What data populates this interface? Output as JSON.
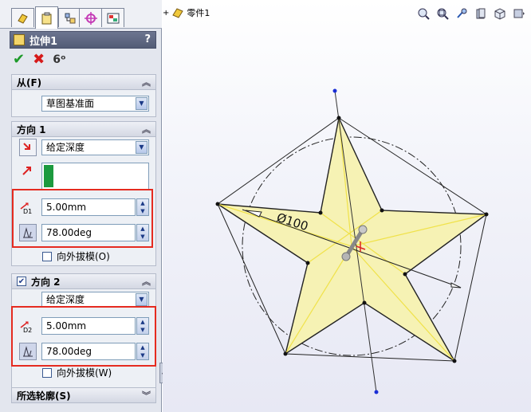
{
  "feature": {
    "title": "拉伸1",
    "help": "?"
  },
  "from": {
    "header": "从(F)",
    "value": "草图基准面"
  },
  "direction1": {
    "header": "方向 1",
    "end_condition": "给定深度",
    "depth": "5.00mm",
    "draft_angle": "78.00deg",
    "draft_outward_label": "向外拔模(O)",
    "depth_icon_label": "D1"
  },
  "direction2": {
    "header": "方向 2",
    "end_condition": "给定深度",
    "depth": "5.00mm",
    "draft_angle": "78.00deg",
    "draft_outward_label": "向外拔模(W)",
    "depth_icon_label": "D2"
  },
  "selected_contours": {
    "header": "所选轮廓(S)"
  },
  "graphics": {
    "tree_item": "零件1",
    "diameter_label": "Ø100"
  },
  "colors": {
    "panel_bg": "#e3e6ee",
    "header_bg": "#5f6882",
    "highlight_red": "#e52b20",
    "star_fill": "#f6f2b4",
    "confirm_green": "#1d9a2a",
    "cancel_red": "#d61a1a"
  }
}
